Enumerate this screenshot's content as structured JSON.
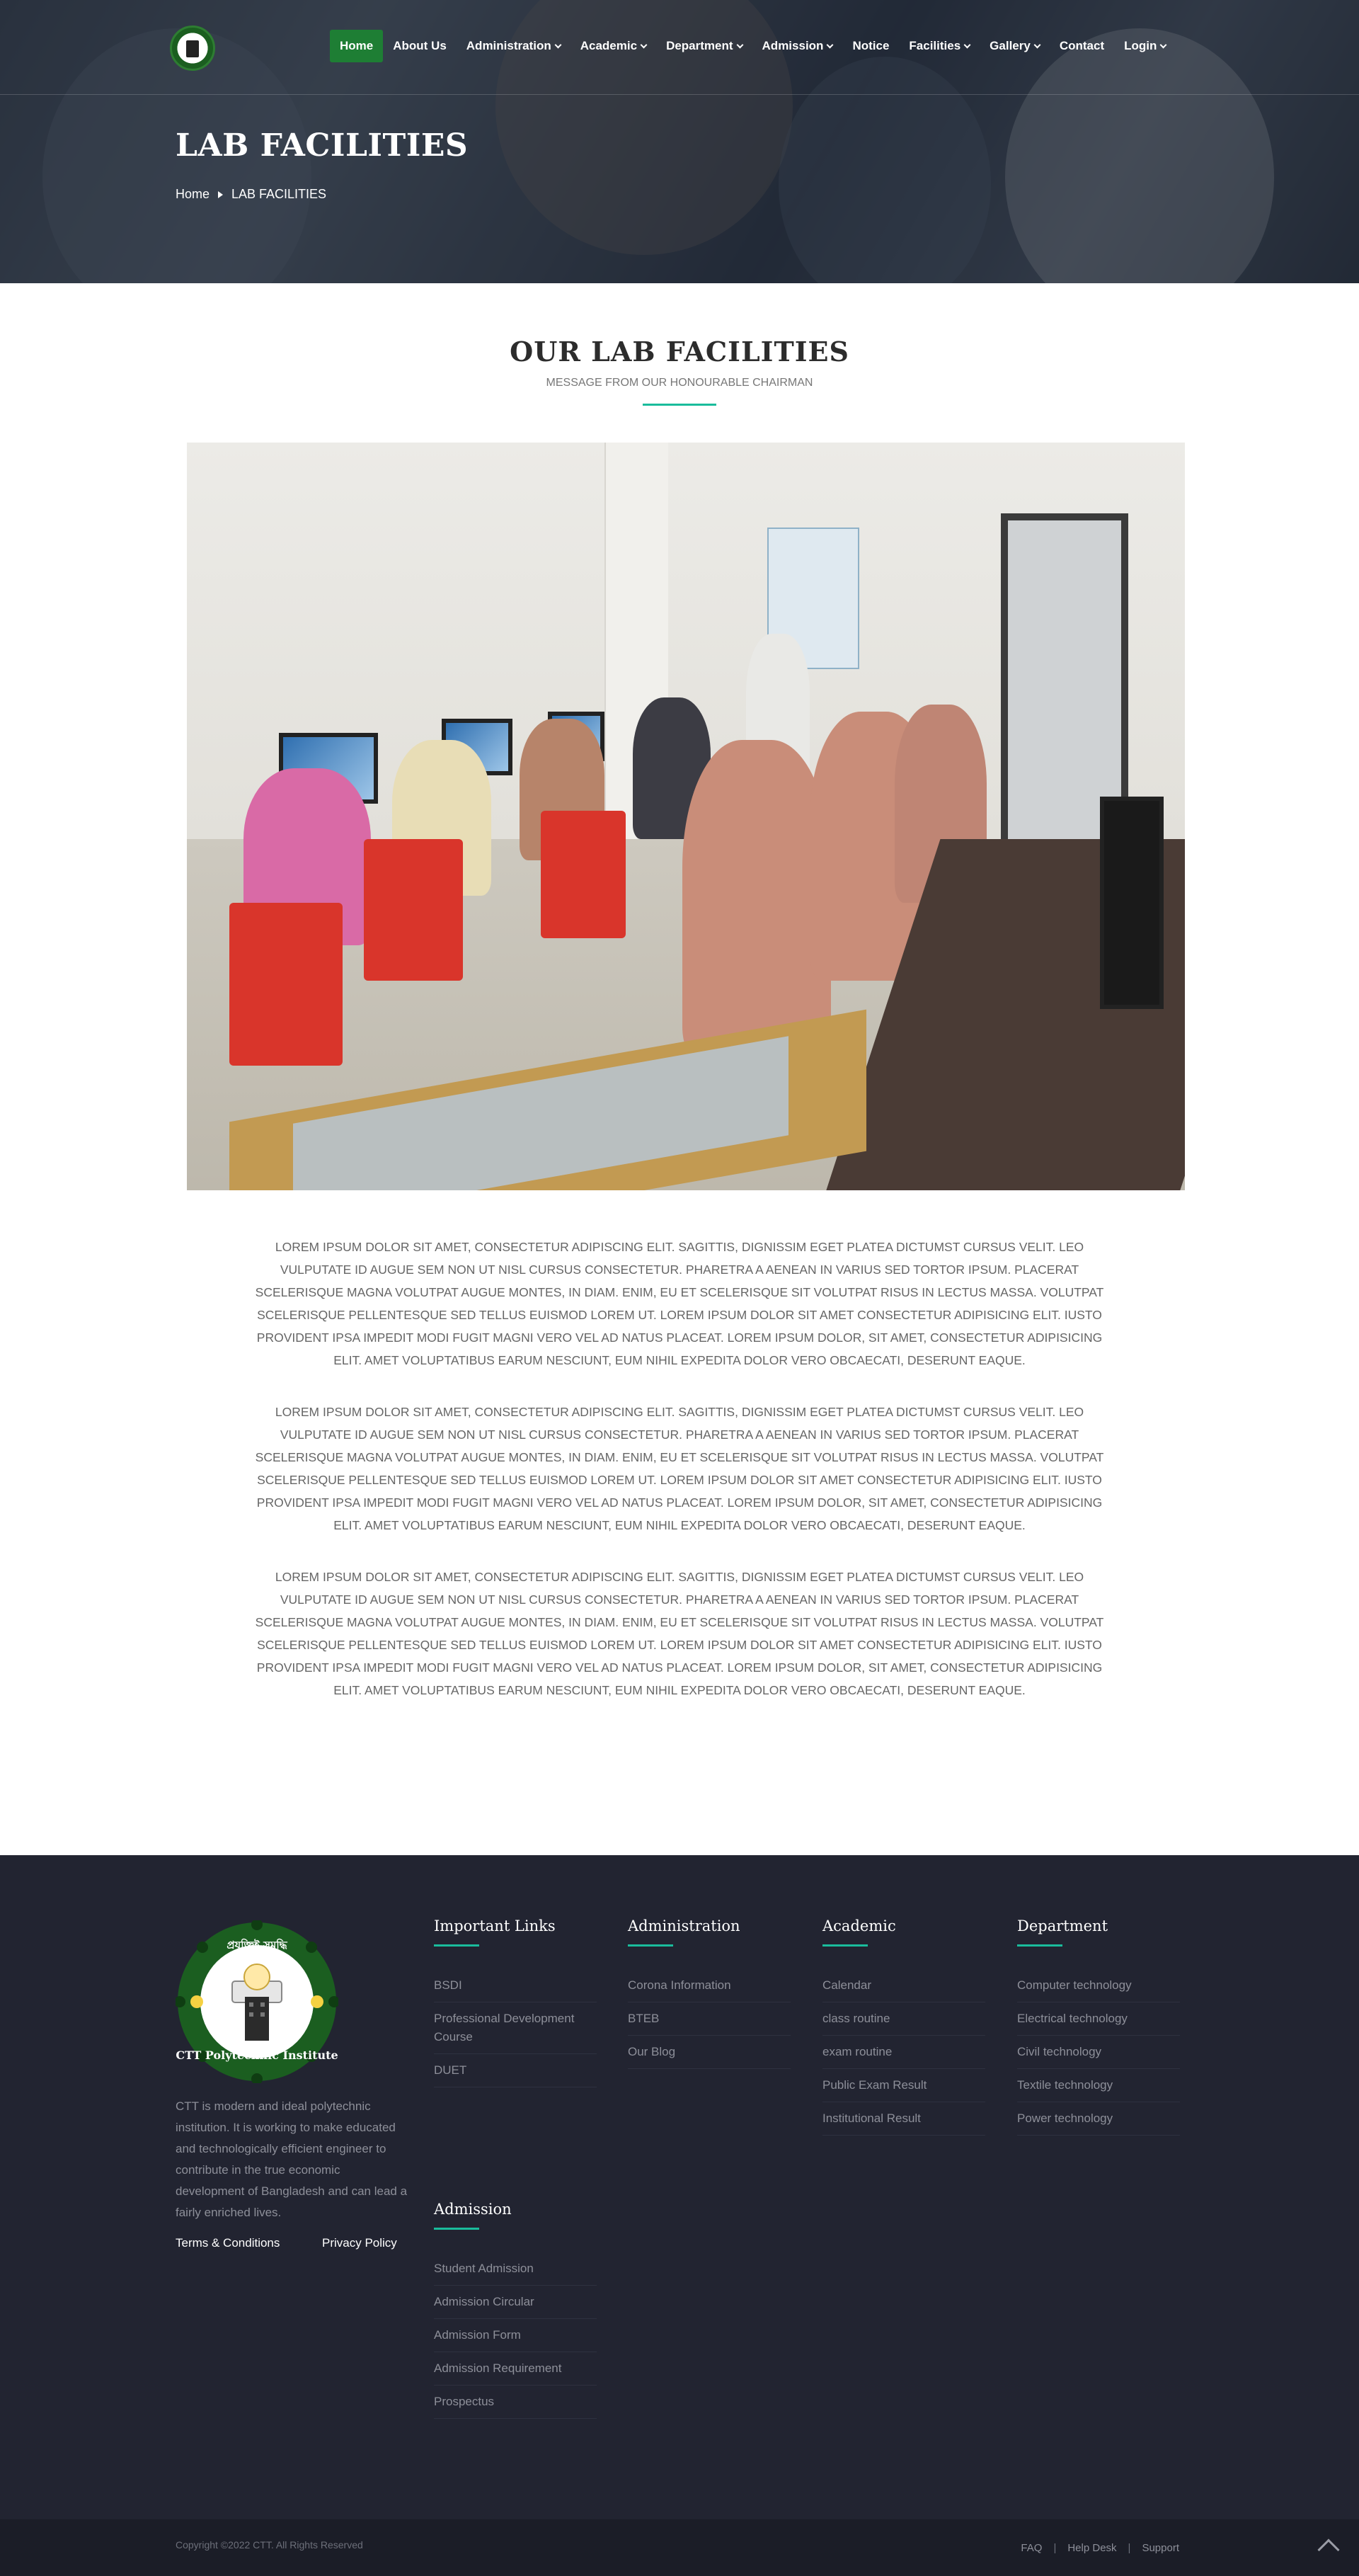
{
  "nav": {
    "items": [
      {
        "label": "Home"
      },
      {
        "label": "About Us"
      },
      {
        "label": "Administration"
      },
      {
        "label": "Academic"
      },
      {
        "label": "Department"
      },
      {
        "label": "Admission"
      },
      {
        "label": "Notice"
      },
      {
        "label": "Facilities"
      },
      {
        "label": "Gallery"
      },
      {
        "label": "Contact"
      },
      {
        "label": "Login"
      }
    ]
  },
  "hero": {
    "title": "LAB FACILITIES",
    "breadcrumb": {
      "home": "Home",
      "current": "LAB FACILITIES"
    }
  },
  "section": {
    "title": "OUR LAB FACILITIES",
    "subtitle": "MESSAGE FROM OUR HONOURABLE CHAIRMAN"
  },
  "content": {
    "paragraphs": [
      "Lorem ipsum dolor sit amet, consectetur adipiscing elit. Sagittis, dignissim eget platea dictumst cursus velit. Leo vulputate id augue sem non ut nisl cursus consectetur. Pharetra a aenean in varius sed tortor ipsum. Placerat scelerisque magna volutpat augue montes, in diam. Enim, eu et scelerisque sit volutpat risus in lectus massa. Volutpat scelerisque pellentesque sed tellus euismod lorem ut. Lorem ipsum dolor sit amet consectetur adipisicing elit. Iusto provident ipsa impedit modi fugit magni vero vel ad natus placeat. Lorem ipsum dolor, sit amet, consectetur adipisicing elit. Amet voluptatibus earum nesciunt, eum nihil expedita dolor vero obcaecati, deserunt eaque.",
      "Lorem ipsum dolor sit amet, consectetur adipiscing elit. Sagittis, dignissim eget platea dictumst cursus velit. Leo vulputate id augue sem non ut nisl cursus consectetur. Pharetra a aenean in varius sed tortor ipsum. Placerat scelerisque magna volutpat augue montes, in diam. Enim, eu et scelerisque sit volutpat risus in lectus massa. Volutpat scelerisque pellentesque sed tellus euismod lorem ut. Lorem ipsum dolor sit amet consectetur adipisicing elit. Iusto provident ipsa impedit modi fugit magni vero vel ad natus placeat. Lorem ipsum dolor, sit amet, consectetur adipisicing elit. Amet voluptatibus earum nesciunt, eum nihil expedita dolor vero obcaecati, deserunt eaque.",
      "Lorem ipsum dolor sit amet, consectetur adipiscing elit. Sagittis, dignissim eget platea dictumst cursus velit. Leo vulputate id augue sem non ut nisl cursus consectetur. Pharetra a aenean in varius sed tortor ipsum. Placerat scelerisque magna volutpat augue montes, in diam. Enim, eu et scelerisque sit volutpat risus in lectus massa. Volutpat scelerisque pellentesque sed tellus euismod lorem ut. Lorem ipsum dolor sit amet consectetur adipisicing elit. Iusto provident ipsa impedit modi fugit magni vero vel ad natus placeat. Lorem ipsum dolor, sit amet, consectetur adipisicing elit. Amet voluptatibus earum nesciunt, eum nihil expedita dolor vero obcaecati, deserunt eaque."
    ]
  },
  "footer": {
    "logo_text": {
      "top": "প্রযুক্তিই সমৃদ্ধি",
      "bottom": "CTT Polytechnic Institute"
    },
    "about": "CTT is modern and ideal polytechnic institution. It is working to make educated and technologically efficient engineer to contribute in the true economic development of Bangladesh and can lead a fairly enriched lives.",
    "terms": "Terms & Conditions",
    "privacy": "Privacy Policy",
    "important_links": {
      "title": "Important Links",
      "links": [
        "BSDI",
        "Professional Development Course",
        "DUET"
      ]
    },
    "administration": {
      "title": "Administration",
      "links": [
        "Corona Information",
        "BTEB",
        "Our Blog"
      ]
    },
    "academic": {
      "title": "Academic",
      "links": [
        "Calendar",
        "class routine",
        "exam routine",
        "Public Exam Result",
        "Institutional Result"
      ]
    },
    "department": {
      "title": "Department",
      "links": [
        "Computer technology",
        "Electrical technology",
        "Civil technology",
        "Textile technology",
        "Power technology"
      ]
    },
    "admission": {
      "title": "Admission",
      "links": [
        "Student Admission",
        "Admission Circular",
        "Admission Form",
        "Admission Requirement",
        "Prospectus"
      ]
    },
    "copyright": "Copyright ©2022 CTT. All Rights Reserved",
    "bottom_links": [
      "FAQ",
      "Help Desk",
      "Support"
    ]
  },
  "colors": {
    "accent": "#1abc9c",
    "nav_active": "#1e7e34",
    "footer_bg": "#222431"
  }
}
